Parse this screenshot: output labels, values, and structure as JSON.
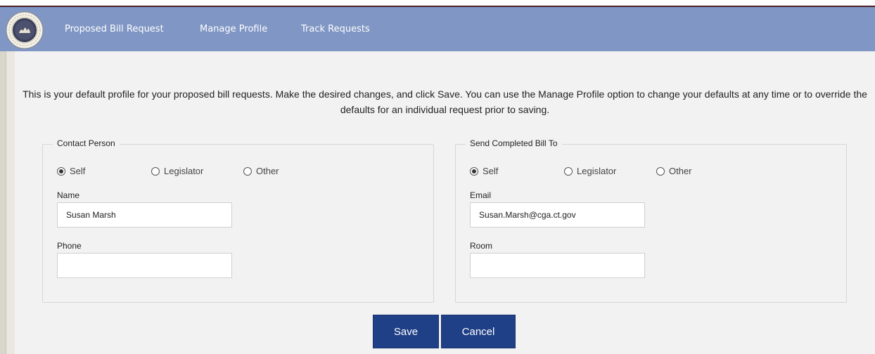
{
  "nav": {
    "logo_alt": "Connecticut General Assembly seal",
    "items": [
      {
        "label": "Proposed Bill Request"
      },
      {
        "label": "Manage Profile"
      },
      {
        "label": "Track Requests"
      }
    ]
  },
  "intro_text": "This is your default profile for your proposed bill requests. Make the desired changes, and click Save. You can use the Manage Profile option to change your defaults at any time or to override the defaults for an individual request prior to saving.",
  "contact": {
    "legend": "Contact Person",
    "options": [
      "Self",
      "Legislator",
      "Other"
    ],
    "selected": "Self",
    "name_label": "Name",
    "name_value": "Susan Marsh",
    "phone_label": "Phone",
    "phone_value": ""
  },
  "send": {
    "legend": "Send Completed Bill To",
    "options": [
      "Self",
      "Legislator",
      "Other"
    ],
    "selected": "Self",
    "email_label": "Email",
    "email_value": "Susan.Marsh@cga.ct.gov",
    "room_label": "Room",
    "room_value": ""
  },
  "buttons": {
    "save": "Save",
    "cancel": "Cancel"
  },
  "colors": {
    "nav_bg": "#8096c4",
    "button_bg": "#1f3f86",
    "page_bg": "#f2f2f2"
  }
}
